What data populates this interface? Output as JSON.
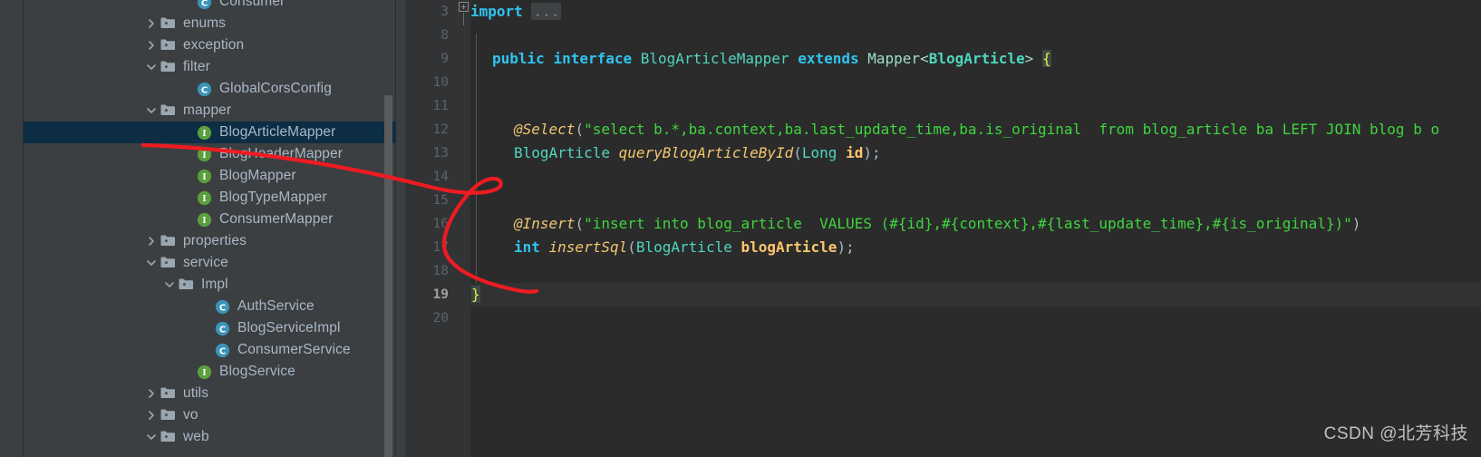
{
  "sidebar": {
    "scrollbar": "vertical-scrollbar",
    "tree": [
      {
        "label": "Consumer",
        "icon": "class-icon",
        "chevron": "none",
        "depth": 4,
        "selected": false,
        "clipped_top": true
      },
      {
        "label": "enums",
        "icon": "folder-icon",
        "chevron": "collapsed",
        "depth": 2,
        "selected": false
      },
      {
        "label": "exception",
        "icon": "folder-icon",
        "chevron": "collapsed",
        "depth": 2,
        "selected": false
      },
      {
        "label": "filter",
        "icon": "folder-icon",
        "chevron": "expanded",
        "depth": 2,
        "selected": false
      },
      {
        "label": "GlobalCorsConfig",
        "icon": "class-icon",
        "chevron": "none",
        "depth": 4,
        "selected": false
      },
      {
        "label": "mapper",
        "icon": "folder-icon",
        "chevron": "expanded",
        "depth": 2,
        "selected": false
      },
      {
        "label": "BlogArticleMapper",
        "icon": "interface-icon",
        "chevron": "none",
        "depth": 4,
        "selected": true
      },
      {
        "label": "BlogHeaderMapper",
        "icon": "interface-icon",
        "chevron": "none",
        "depth": 4,
        "selected": false
      },
      {
        "label": "BlogMapper",
        "icon": "interface-icon",
        "chevron": "none",
        "depth": 4,
        "selected": false
      },
      {
        "label": "BlogTypeMapper",
        "icon": "interface-icon",
        "chevron": "none",
        "depth": 4,
        "selected": false
      },
      {
        "label": "ConsumerMapper",
        "icon": "interface-icon",
        "chevron": "none",
        "depth": 4,
        "selected": false
      },
      {
        "label": "properties",
        "icon": "folder-icon",
        "chevron": "collapsed",
        "depth": 2,
        "selected": false
      },
      {
        "label": "service",
        "icon": "folder-icon",
        "chevron": "expanded",
        "depth": 2,
        "selected": false
      },
      {
        "label": "Impl",
        "icon": "folder-icon",
        "chevron": "expanded",
        "depth": 3,
        "selected": false
      },
      {
        "label": "AuthService",
        "icon": "class-icon",
        "chevron": "none",
        "depth": 5,
        "selected": false
      },
      {
        "label": "BlogServiceImpl",
        "icon": "class-icon",
        "chevron": "none",
        "depth": 5,
        "selected": false
      },
      {
        "label": "ConsumerService",
        "icon": "class-icon",
        "chevron": "none",
        "depth": 5,
        "selected": false
      },
      {
        "label": "BlogService",
        "icon": "interface-icon",
        "chevron": "none",
        "depth": 4,
        "selected": false
      },
      {
        "label": "utils",
        "icon": "folder-icon",
        "chevron": "collapsed",
        "depth": 2,
        "selected": false
      },
      {
        "label": "vo",
        "icon": "folder-icon",
        "chevron": "collapsed",
        "depth": 2,
        "selected": false
      },
      {
        "label": "web",
        "icon": "folder-icon",
        "chevron": "expanded",
        "depth": 2,
        "selected": false,
        "clipped_bottom": true
      }
    ]
  },
  "editor": {
    "line_numbers": [
      "3",
      "8",
      "9",
      "10",
      "11",
      "12",
      "13",
      "14",
      "15",
      "16",
      "17",
      "18",
      "19",
      "20"
    ],
    "current_line_number": "19",
    "fold_marker": "import-fold-expander",
    "lines": [
      {
        "num": "3",
        "kind": "import"
      },
      {
        "num": "8",
        "kind": "blank"
      },
      {
        "num": "9",
        "kind": "interface_decl"
      },
      {
        "num": "10",
        "kind": "blank"
      },
      {
        "num": "11",
        "kind": "blank"
      },
      {
        "num": "12",
        "kind": "select_anno"
      },
      {
        "num": "13",
        "kind": "select_method"
      },
      {
        "num": "14",
        "kind": "blank"
      },
      {
        "num": "15",
        "kind": "blank"
      },
      {
        "num": "16",
        "kind": "insert_anno"
      },
      {
        "num": "17",
        "kind": "insert_method"
      },
      {
        "num": "18",
        "kind": "blank"
      },
      {
        "num": "19",
        "kind": "close_brace"
      },
      {
        "num": "20",
        "kind": "blank"
      }
    ],
    "tokens": {
      "import_kw": "import",
      "import_fold": "...",
      "public": "public",
      "interface": "interface",
      "iface_name": "BlogArticleMapper",
      "extends": "extends",
      "mapper_open": "Mapper<",
      "mapper_generic": "BlogArticle",
      "mapper_close": "> ",
      "open_brace": "{",
      "select_anno": "@Select",
      "select_paren": "(",
      "select_sql": "\"select b.*,ba.context,ba.last_update_time,ba.is_original  from blog_article ba LEFT JOIN blog b o",
      "select_ret": "BlogArticle ",
      "select_name": "queryBlogArticleById",
      "select_args_open": "(",
      "select_arg_type": "Long ",
      "select_arg_name": "id",
      "select_args_close": ");",
      "insert_anno": "@Insert",
      "insert_paren": "(",
      "insert_sql": "\"insert into blog_article  VALUES (#{id},#{context},#{last_update_time},#{is_original})\"",
      "insert_paren_close": ")",
      "insert_ret": "int ",
      "insert_name": "insertSql",
      "insert_args_open": "(",
      "insert_arg_type": "BlogArticle ",
      "insert_arg_name": "blogArticle",
      "insert_args_close": ");",
      "close_brace": "}"
    }
  },
  "annotation": {
    "name": "red-pen-curve",
    "color": "#ee1c22"
  },
  "watermark": {
    "text": "CSDN @北芳科技"
  },
  "colors": {
    "sidebar_bg": "#3c3f41",
    "editor_bg": "#2b2b2b",
    "gutter_bg": "#313335",
    "selection_bg": "#0d2d45",
    "tree_text": "#a9b7c6",
    "keyword": "#2fc4f0",
    "string": "#3fd53f",
    "annotation_token": "#f0c674",
    "identifier": "#ffc66d",
    "type_token": "#4fd6c0",
    "brace": "#f0e442",
    "line_number": "#606366",
    "interface_icon": "#5a9f3d",
    "class_icon": "#3b94b8",
    "folder_icon": "#9aa7b0",
    "accent_red": "#ee1c22"
  }
}
